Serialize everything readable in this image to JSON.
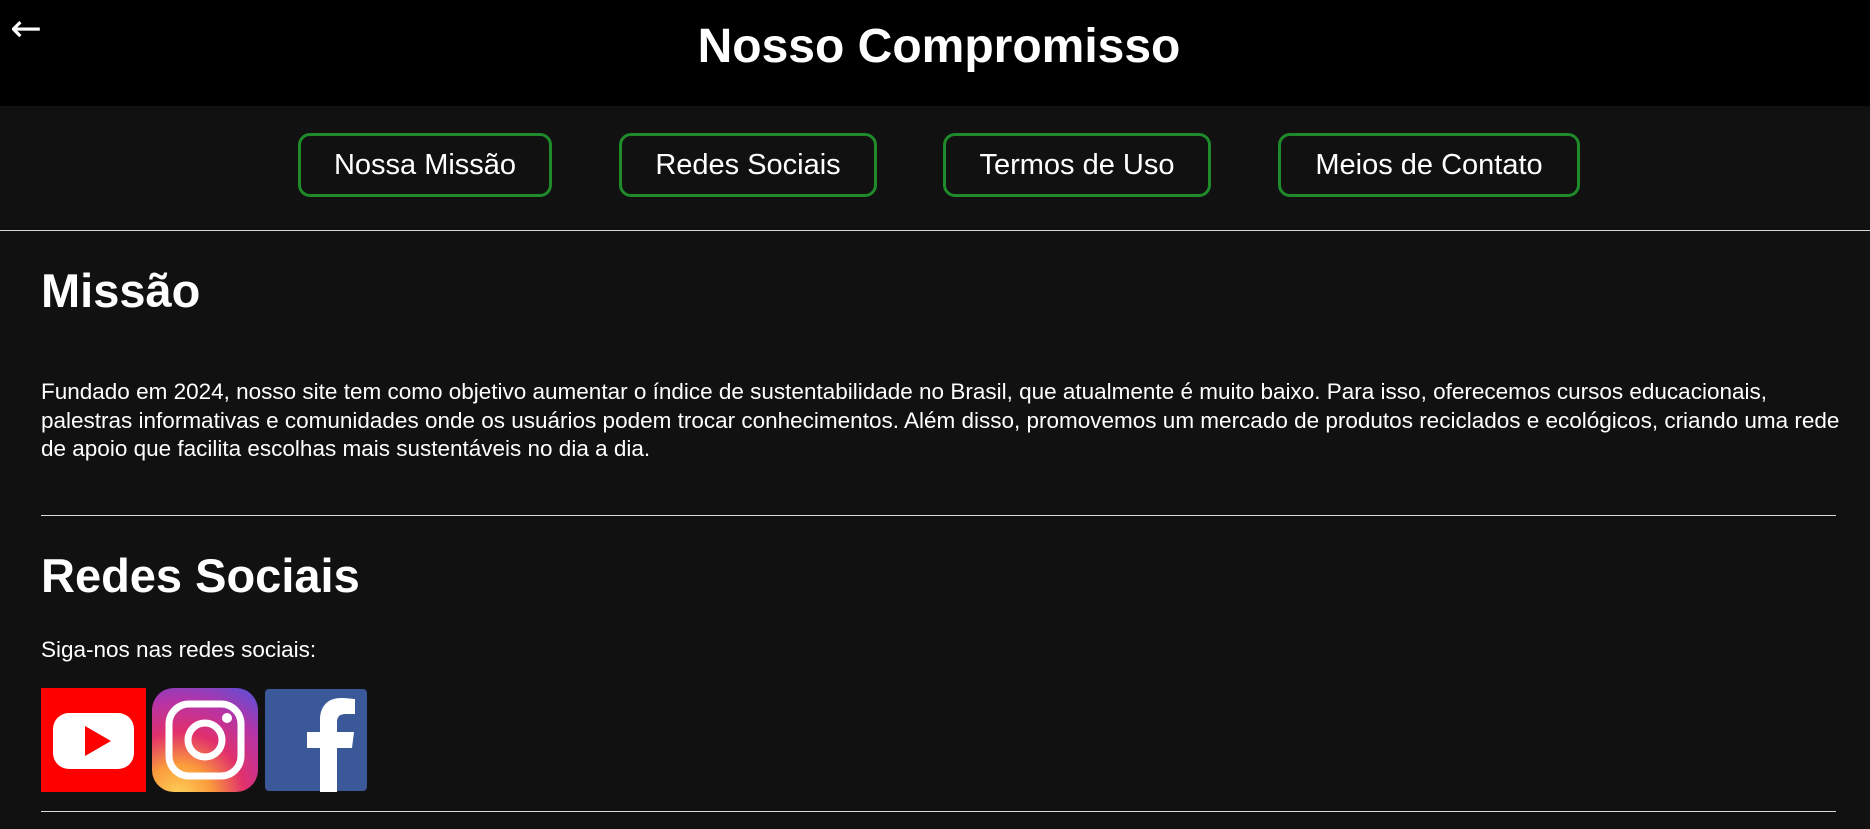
{
  "header": {
    "back_symbol": "←",
    "title": "Nosso Compromisso"
  },
  "nav": {
    "items": [
      {
        "label": "Nossa Missão"
      },
      {
        "label": "Redes Sociais"
      },
      {
        "label": "Termos de Uso"
      },
      {
        "label": "Meios de Contato"
      }
    ],
    "border_color": "#1f8a2a"
  },
  "mission": {
    "heading": "Missão",
    "text": "Fundado em 2024, nosso site tem como objetivo aumentar o índice de sustentabilidade no Brasil, que atualmente é muito baixo. Para isso, oferecemos cursos educacionais, palestras informativas e comunidades onde os usuários podem trocar conhecimentos. Além disso, promovemos um mercado de produtos reciclados e ecológicos, criando uma rede de apoio que facilita escolhas mais sustentáveis no dia a dia."
  },
  "social": {
    "heading": "Redes Sociais",
    "intro": "Siga-nos nas redes sociais:",
    "icons": [
      "youtube-icon",
      "instagram-icon",
      "facebook-icon"
    ],
    "colors": {
      "youtube": "#ff0000",
      "facebook": "#3b5998"
    }
  },
  "theme": {
    "background": "#111111",
    "header_background": "#000000",
    "text": "#ffffff"
  }
}
